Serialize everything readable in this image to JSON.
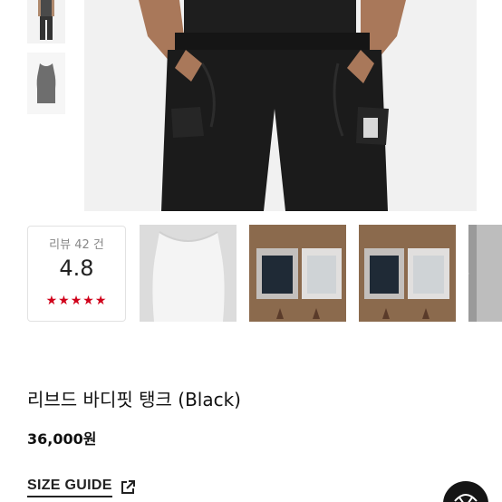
{
  "gallery": {
    "review": {
      "label": "리뷰 42 건",
      "score": "4.8",
      "stars": "★★★★★",
      "rating_count": 5
    },
    "thumbnails": [
      {
        "alt": "민소매 탱크 흰색"
      },
      {
        "alt": "포장된 제품 사진"
      },
      {
        "alt": "포장된 제품 사진"
      },
      {
        "alt": "포장된 제품 사진"
      }
    ],
    "next_icon": "chevron-right-icon"
  },
  "product": {
    "title": "리브드 바디핏 탱크 (Black)",
    "price": "36,000원"
  },
  "size_guide": {
    "label": "SIZE GUIDE",
    "icon": "external-link-icon"
  },
  "colors": {
    "star": "#d0021b",
    "text": "#222222",
    "fab": "#151515"
  }
}
